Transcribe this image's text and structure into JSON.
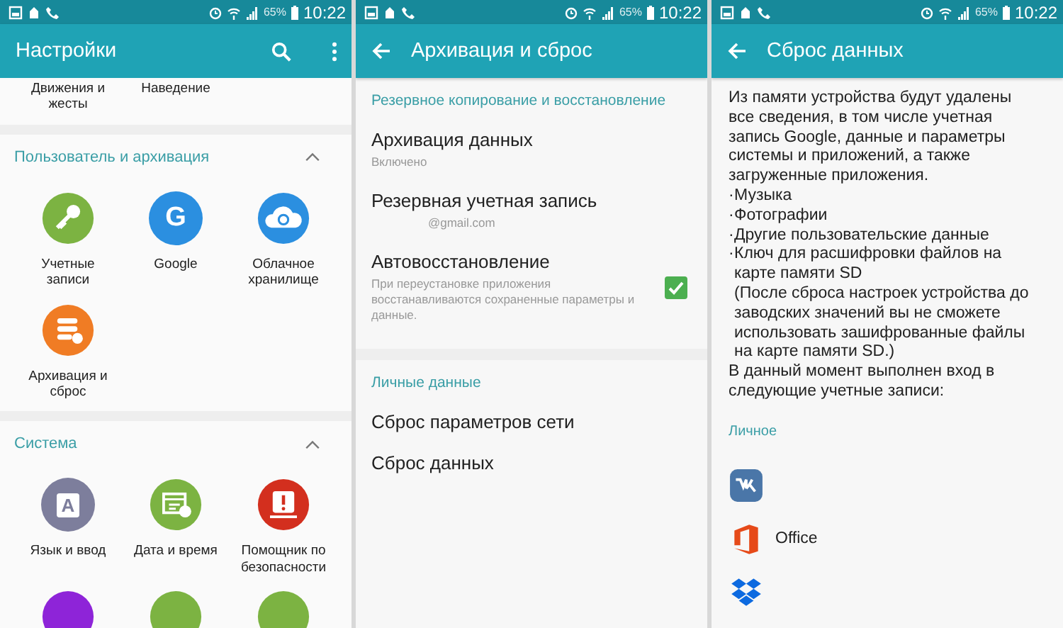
{
  "settings_screen": {
    "status_bar": {
      "battery": "65%",
      "time": "10:22"
    },
    "title": "Настройки",
    "top_row": [
      "Движения и жесты",
      "Наведение"
    ],
    "sections": [
      {
        "title": "Пользователь и архивация",
        "expanded": true,
        "items": [
          {
            "kind": "key",
            "label": "Учетные записи",
            "color": "#7cb342"
          },
          {
            "kind": "letter",
            "glyph": "G",
            "label": "Google",
            "color": "#2b8fe0"
          },
          {
            "kind": "cloud",
            "label": "Облачное хранилище",
            "color": "#2b8fe0"
          },
          {
            "kind": "database",
            "label": "Архивация и сброс",
            "color": "#f07c24"
          }
        ]
      },
      {
        "title": "Система",
        "expanded": true,
        "items": [
          {
            "kind": "letter",
            "glyph": "A",
            "label": "Язык и ввод",
            "color": "#7d7e9c"
          },
          {
            "kind": "calendar",
            "label": "Дата и время",
            "color": "#7cb342"
          },
          {
            "kind": "alert",
            "label": "Помощник по безопасности",
            "color": "#d32f1e"
          },
          {
            "kind": "blank",
            "color": "#8e24d8"
          },
          {
            "kind": "blank",
            "color": "#7cb342"
          },
          {
            "kind": "blank",
            "color": "#7cb342"
          }
        ]
      }
    ]
  },
  "backup_screen": {
    "status_bar": {
      "battery": "65%",
      "time": "10:22"
    },
    "title": "Архивация и сброс",
    "sections": [
      {
        "title": "Резервное копирование и восстановление",
        "items": [
          {
            "kind": "plain",
            "title": "Архивация данных",
            "subtitle": "Включено"
          },
          {
            "kind": "plain",
            "title": "Резервная учетная запись",
            "subtitle": "@gmail.com"
          },
          {
            "kind": "checkbox",
            "title": "Автовосстановление",
            "subtitle": "При переустановке приложения восстанавливаются сохраненные параметры и данные.",
            "checked": true
          }
        ]
      },
      {
        "title": "Личные данные",
        "items": [
          {
            "kind": "plain",
            "title": "Сброс параметров сети"
          },
          {
            "kind": "plain",
            "title": "Сброс данных"
          }
        ]
      }
    ]
  },
  "reset_screen": {
    "status_bar": {
      "battery": "65%",
      "time": "10:22"
    },
    "title": "Сброс данных",
    "intro": "Из памяти устройства будут удалены все сведения, в том числе учетная запись Google, данные и параметры системы и приложений, а также загруженные приложения.",
    "bullets": [
      {
        "marker": "·",
        "text": "Музыка"
      },
      {
        "marker": "·",
        "text": "Фотографии"
      },
      {
        "marker": "·",
        "text": "Другие пользовательские данные"
      },
      {
        "marker": "·",
        "text": "Ключ для расшифровки файлов на карте памяти SD"
      }
    ],
    "note": "(После сброса настроек устройства до заводских значений вы не сможете использовать зашифрованные файлы на карте памяти SD.)",
    "signed_in": "В данный момент выполнен вход в следующие учетные записи:",
    "section_title": "Личное",
    "accounts": [
      {
        "kind": "vk"
      },
      {
        "kind": "office",
        "label": "Office"
      },
      {
        "kind": "dropbox"
      }
    ]
  }
}
